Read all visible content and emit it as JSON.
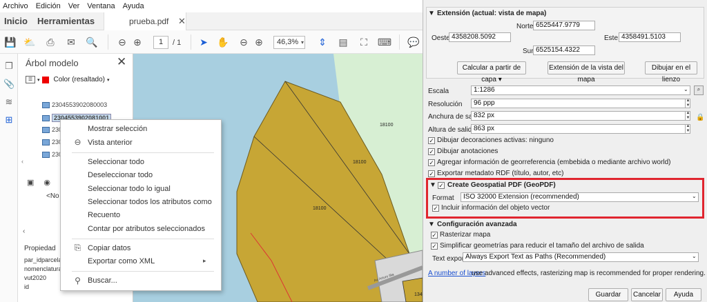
{
  "acrobat": {
    "menu": [
      "Archivo",
      "Edición",
      "Ver",
      "Ventana",
      "Ayuda"
    ],
    "tabs": {
      "home": "Inicio",
      "tools": "Herramientas",
      "doc": "prueba.pdf"
    },
    "page_current": "1",
    "page_total": "/ 1",
    "zoom": "46,3%",
    "panel_title": "Árbol modelo",
    "color_label": "Color (resaltado)",
    "tree_items": [
      "2304553902080003",
      "2304553902081001",
      "230",
      "230",
      "230"
    ],
    "no_label": "<No",
    "property_header": "Propiedad",
    "properties": [
      "par_idparcela",
      "nomenclatura",
      "vut2020",
      "id"
    ],
    "map_labels": [
      "18100",
      "18100",
      "18100",
      "18100",
      "134"
    ],
    "street_label": "Av. Arturo Illia"
  },
  "context_menu": {
    "items": [
      {
        "label": "Mostrar selección",
        "icon": ""
      },
      {
        "label": "Vista anterior",
        "icon": "back-arrow-icon"
      },
      {
        "label": "Seleccionar todo",
        "icon": ""
      },
      {
        "label": "Deseleccionar todo",
        "icon": ""
      },
      {
        "label": "Seleccionar todo lo igual",
        "icon": ""
      },
      {
        "label": "Seleccionar todos los atributos como",
        "icon": ""
      },
      {
        "label": "Recuento",
        "icon": ""
      },
      {
        "label": "Contar por atributos seleccionados",
        "icon": ""
      },
      {
        "label": "Copiar datos",
        "icon": "copy-icon"
      },
      {
        "label": "Exportar como XML",
        "icon": ""
      },
      {
        "label": "Buscar...",
        "icon": "search-icon"
      }
    ],
    "submenu_arrow": "▸"
  },
  "qgis": {
    "extent_title": "Extensión (actual: vista de mapa)",
    "north_label": "Norte",
    "north": "6525447.9779",
    "west_label": "Oeste",
    "west": "4358208.5092",
    "east_label": "Este",
    "east": "4358491.5103",
    "south_label": "Sur",
    "south": "6525154.4322",
    "btn_layer": "Calcular a partir de capa",
    "btn_canvas_extent": "Extensión de la vista del mapa",
    "btn_draw": "Dibujar en el lienzo",
    "scale_label": "Escala",
    "scale": "1:1286",
    "res_label": "Resolución",
    "res": "96 ppp",
    "width_label": "Anchura de salida",
    "width": "832 px",
    "height_label": "Altura de salida",
    "height": "863 px",
    "chk_decor": "Dibujar decoraciones activas: ninguno",
    "chk_annot": "Dibujar anotaciones",
    "chk_georef": "Agregar información de georreferencia (embebida o mediante archivo world)",
    "chk_rdf": "Exportar metadato RDF (título, autor, etc)",
    "geopdf_title": "Create Geospatial PDF (GeoPDF)",
    "format_label": "Format",
    "format": "ISO 32000 Extension (recommended)",
    "chk_vector": "Incluir información del objeto vector",
    "adv_title": "Configuración avanzada",
    "chk_raster": "Rasterizar mapa",
    "chk_simplify": "Simplificar geometrías para reducir el tamaño del archivo de salida",
    "text_export_label": "Text export",
    "text_export": "Always Export Text as Paths (Recommended)",
    "note_link": "A number of layers",
    "note_rest": " use advanced effects, rasterizing map is recommended for proper rendering.",
    "btn_save": "Guardar",
    "btn_cancel": "Cancelar",
    "btn_help": "Ayuda"
  }
}
